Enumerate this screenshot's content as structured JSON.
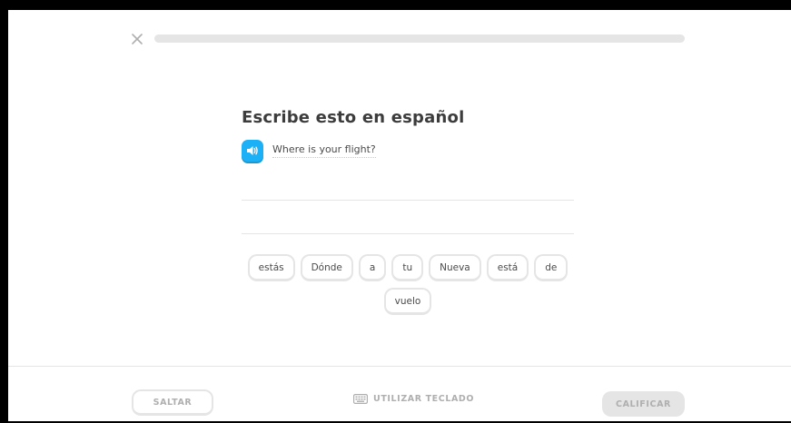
{
  "header": {
    "close_icon": "close-icon",
    "progress_fraction": 0
  },
  "exercise": {
    "title": "Escribe esto en español",
    "prompt_icon": "speaker-icon",
    "prompt": "Where is your flight?"
  },
  "word_bank": [
    "estás",
    "Dónde",
    "a",
    "tu",
    "Nueva",
    "está",
    "de",
    "vuelo"
  ],
  "footer": {
    "skip_label": "SALTAR",
    "keyboard_icon": "keyboard-icon",
    "keyboard_label": "UTILIZAR TECLADO",
    "check_label": "CALIFICAR"
  },
  "colors": {
    "accent_blue": "#1cb0f6",
    "disabled_gray": "#e5e5e5",
    "muted_text": "#afafaf",
    "title_text": "#3c3c3c"
  }
}
